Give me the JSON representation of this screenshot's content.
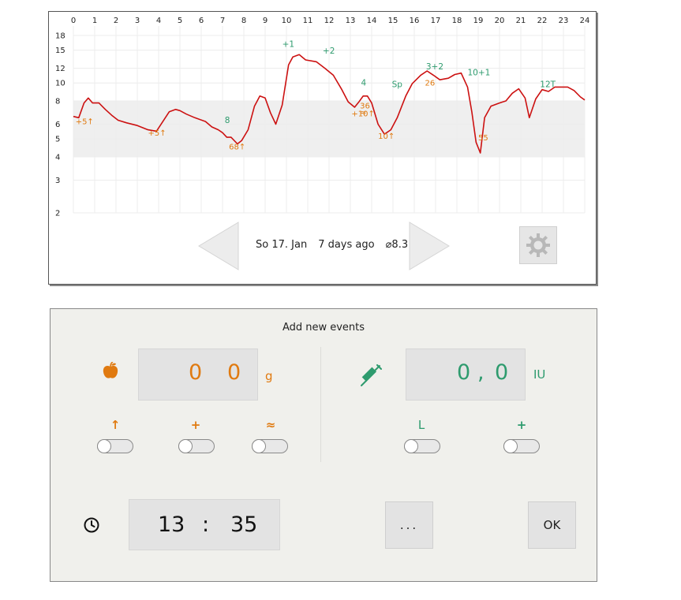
{
  "chart": {
    "x_ticks": [
      "0",
      "1",
      "2",
      "3",
      "4",
      "5",
      "6",
      "7",
      "8",
      "9",
      "10",
      "11",
      "12",
      "13",
      "14",
      "15",
      "16",
      "17",
      "18",
      "19",
      "20",
      "21",
      "22",
      "23",
      "24"
    ],
    "y_ticks": [
      "2",
      "3",
      "4",
      "5",
      "6",
      "8",
      "10",
      "12",
      "15",
      "18"
    ],
    "annotations_green": [
      "+1",
      "+2",
      "4",
      "Sp",
      "3+2",
      "10+1",
      "8",
      "12T"
    ],
    "annotations_orange": [
      "+5↑",
      "+5↑",
      "68↑",
      "+10↑",
      "36",
      "≈",
      "10↑",
      "26",
      "55"
    ],
    "colors": {
      "line": "#cc1111",
      "green": "#2e9b6e",
      "orange": "#e07a10",
      "band": "#efefef"
    }
  },
  "chart_data": {
    "type": "line",
    "title": "",
    "xlabel": "",
    "ylabel": "",
    "xlim": [
      0,
      24
    ],
    "ylim": [
      2,
      18
    ],
    "y_scale": "log",
    "target_band": [
      4,
      8
    ],
    "grid": true,
    "series": [
      {
        "values_x": [
          0,
          0.25,
          0.5,
          0.7,
          0.9,
          1.2,
          1.5,
          1.8,
          2.1,
          2.5,
          3.0,
          3.5,
          3.9,
          4.2,
          4.5,
          4.8,
          5.0,
          5.3,
          5.7,
          6.2,
          6.5,
          6.8,
          7.0,
          7.2,
          7.4,
          7.7,
          7.9,
          8.2,
          8.5,
          8.75,
          9.0,
          9.25,
          9.5,
          9.8,
          10.1,
          10.3,
          10.6,
          10.9,
          11.4,
          11.8,
          12.2,
          12.6,
          12.9,
          13.2,
          13.4,
          13.6,
          13.8,
          14.0,
          14.3,
          14.6,
          14.9,
          15.2,
          15.6,
          15.9,
          16.3,
          16.6,
          16.9,
          17.2,
          17.6,
          17.9,
          18.2,
          18.5,
          18.7,
          18.9,
          19.1,
          19.3,
          19.6,
          20.0,
          20.3,
          20.6,
          20.9,
          21.2,
          21.4,
          21.7,
          22.0,
          22.3,
          22.6,
          22.9,
          23.2,
          23.5,
          23.8,
          24.0
        ],
        "values_y": [
          6.6,
          6.5,
          7.8,
          8.3,
          7.8,
          7.8,
          7.2,
          6.7,
          6.3,
          6.1,
          5.9,
          5.6,
          5.5,
          6.2,
          7.0,
          7.2,
          7.1,
          6.8,
          6.5,
          6.2,
          5.8,
          5.6,
          5.4,
          5.1,
          5.1,
          4.7,
          4.9,
          5.6,
          7.5,
          8.5,
          8.3,
          6.9,
          6.0,
          7.6,
          12.5,
          13.8,
          14.2,
          13.3,
          13.0,
          12.0,
          11.0,
          9.2,
          7.9,
          7.4,
          7.9,
          8.5,
          8.5,
          7.8,
          6.0,
          5.3,
          5.6,
          6.5,
          8.5,
          9.9,
          11.0,
          11.6,
          11.0,
          10.4,
          10.6,
          11.1,
          11.3,
          9.5,
          7.0,
          4.8,
          4.2,
          6.5,
          7.5,
          7.8,
          8.0,
          8.8,
          9.3,
          8.3,
          6.5,
          8.2,
          9.2,
          9.0,
          9.5,
          9.5,
          9.5,
          9.1,
          8.4,
          8.1
        ]
      }
    ]
  },
  "nav": {
    "date": "So 17. Jan",
    "relative": "7 days ago",
    "average": "⌀8.3"
  },
  "events": {
    "title": "Add new events",
    "carbs": {
      "digit1": "0",
      "digit2": "0",
      "unit": "g"
    },
    "insulin": {
      "digit1": "0",
      "comma": ",",
      "digit2": "0",
      "unit": "IU"
    },
    "toggles_left": [
      {
        "label": "↑",
        "color": "#e07a10"
      },
      {
        "label": "+",
        "color": "#e07a10"
      },
      {
        "label": "≈",
        "color": "#e07a10"
      }
    ],
    "toggles_right": [
      {
        "label": "L",
        "color": "#2e9b6e"
      },
      {
        "label": "+",
        "color": "#2e9b6e"
      }
    ],
    "time": {
      "hours": "13",
      "separator": ":",
      "minutes": "35"
    },
    "more_label": "...",
    "ok_label": "OK"
  },
  "icons": [
    "apple-icon",
    "syringe-icon",
    "clock-icon",
    "gear-icon",
    "left-arrow-icon",
    "right-arrow-icon"
  ]
}
